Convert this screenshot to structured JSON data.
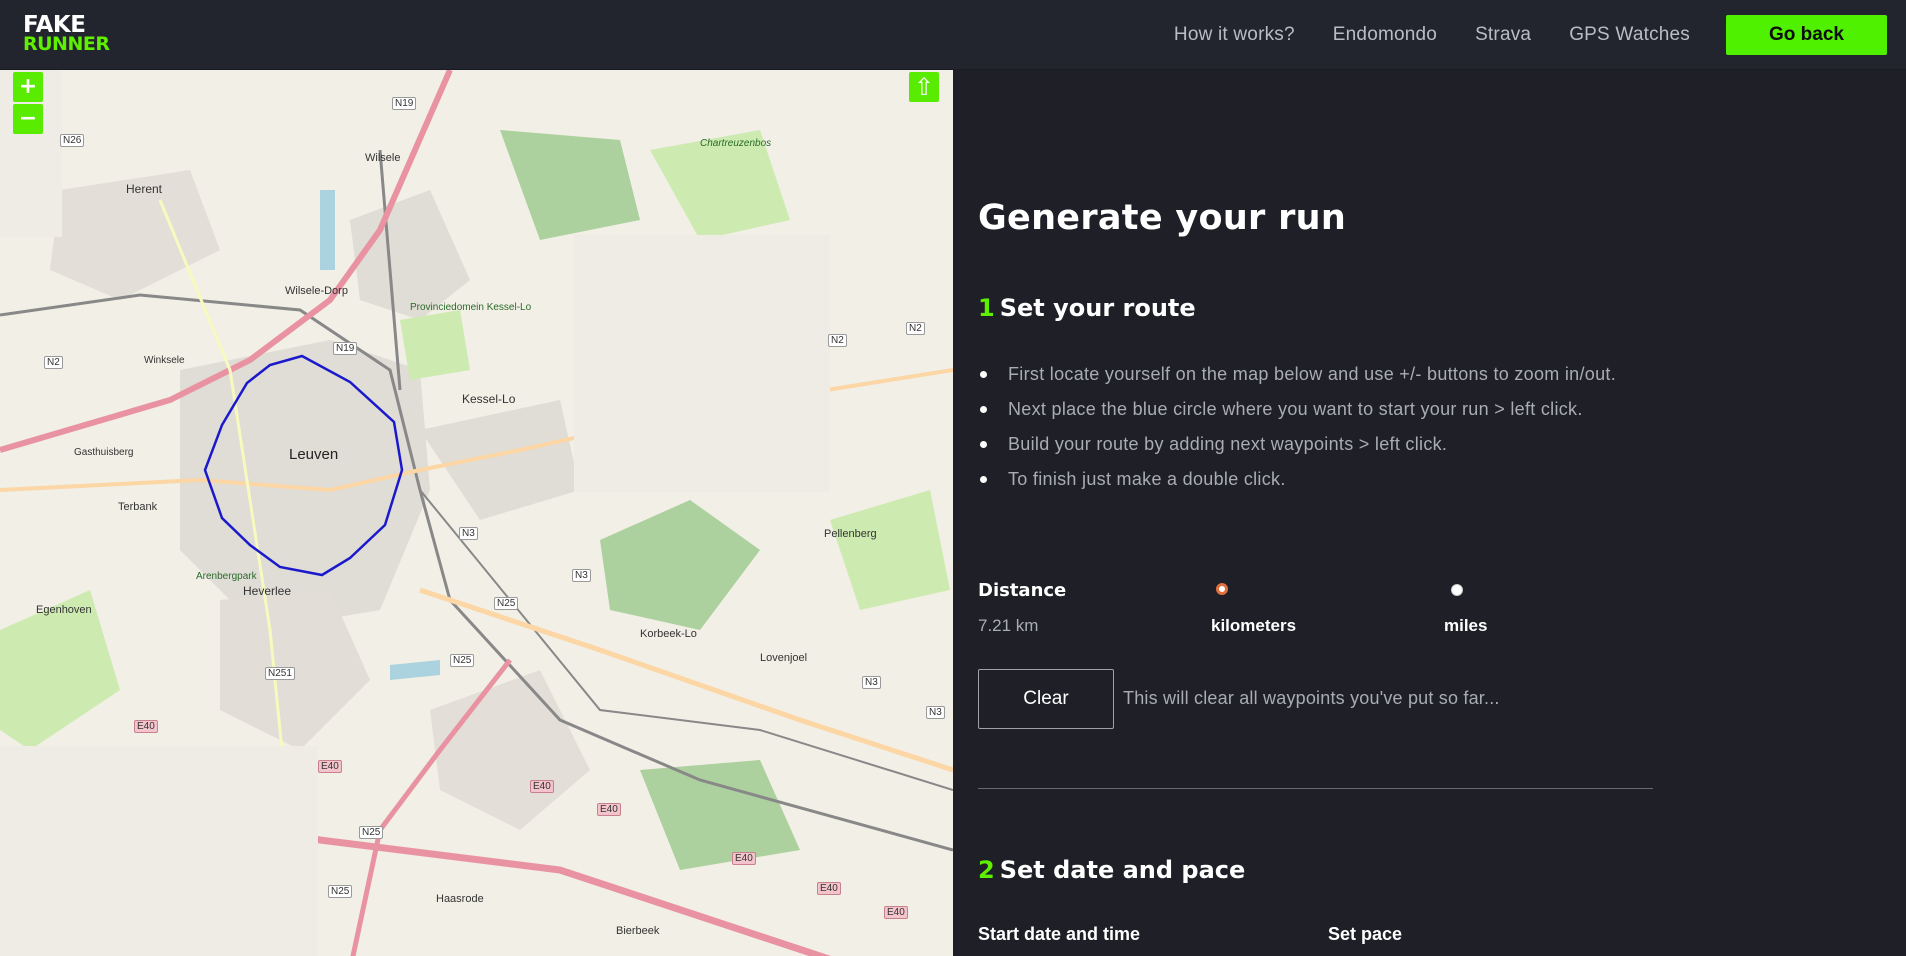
{
  "header": {
    "logo_line1": "FAKE",
    "logo_line2": "RUNNER",
    "nav": [
      "How it works?",
      "Endomondo",
      "Strava",
      "GPS Watches"
    ],
    "go_back_label": "Go back"
  },
  "map": {
    "zoom_in": "+",
    "zoom_out": "−",
    "up_icon": "⇧",
    "labels": {
      "leuven": "Leuven",
      "herent": "Herent",
      "wilsele": "Wilsele",
      "wilsele_dorp": "Wilsele-Dorp",
      "kessel_lo": "Kessel-Lo",
      "heverlee": "Heverlee",
      "korbeek_lo": "Korbeek-Lo",
      "pellenberg": "Pellenberg",
      "lovenjoel": "Lovenjoel",
      "terbank": "Terbank",
      "egenhoven": "Egenhoven",
      "bierbeek": "Bierbeek",
      "haasrode": "Haasrode",
      "winksele": "Winksele",
      "gasthuisberg": "Gasthuisberg",
      "provinciedomein": "Provinciedomein Kessel-Lo",
      "arenbergpark": "Arenbergpark",
      "chartreuzenbos": "Chartreuzenbos",
      "n19": "N19",
      "n19b": "N19",
      "n2": "N2",
      "n2b": "N2",
      "n2c": "N2",
      "n3": "N3",
      "n3b": "N3",
      "n3c": "N3",
      "n3d": "N3",
      "n25": "N25",
      "n25b": "N25",
      "n25c": "N25",
      "n25d": "N25",
      "n251": "N251",
      "n26": "N26",
      "e40": "E40",
      "e40b": "E40",
      "e40c": "E40",
      "e40d": "E40",
      "e40e": "E40",
      "e40f": "E40",
      "e40g": "E40"
    }
  },
  "panel": {
    "title": "Generate your run",
    "step1_num": "1",
    "step1_title": "Set your route",
    "instructions": [
      "First locate yourself on the map below and use +/- buttons to zoom in/out.",
      "Next place the blue circle where you want to start your run > left click.",
      "Build your route by adding next waypoints > left click.",
      "To finish just make a double click."
    ],
    "distance_label": "Distance",
    "distance_value": "7.21 km",
    "unit_km": "kilometers",
    "unit_mi": "miles",
    "selected_unit": "kilometers",
    "clear_label": "Clear",
    "clear_note": "This will clear all waypoints you've put so far...",
    "step2_num": "2",
    "step2_title": "Set date and pace",
    "start_label": "Start date and time",
    "pace_label": "Set pace"
  },
  "colors": {
    "accent": "#5ef000",
    "background": "#1e1f27",
    "route": "#1a1acc",
    "radio_selected": "#e0703f"
  }
}
